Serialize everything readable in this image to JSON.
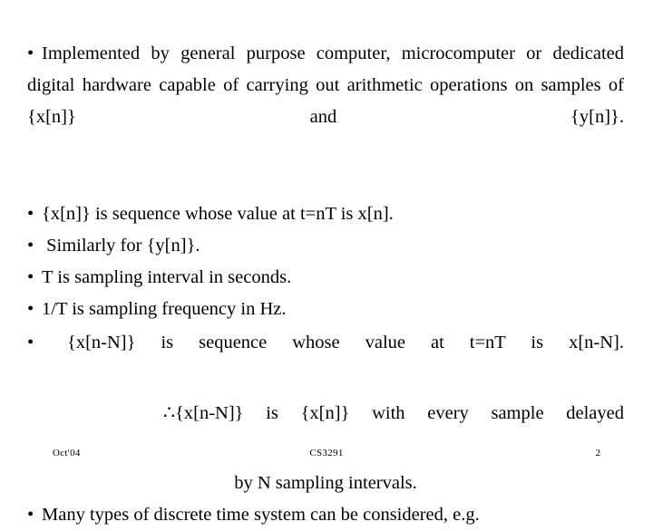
{
  "slide": {
    "background_color": "#ffffff",
    "text_color": "#000000",
    "bullet_glyph": "•",
    "therefore_glyph": "∴"
  },
  "body": {
    "paragraph_1": {
      "bullet": "•",
      "text": "Implemented by general purpose computer, microcomputer or dedicated digital hardware capable of carrying out arithmetic operations on samples of  {x[n]}  and  {y[n]}."
    },
    "bullets": [
      {
        "bullet": "•",
        "text": "{x[n]} is sequence whose value at t=nT is x[n]."
      },
      {
        "bullet": "•",
        "text": " Similarly for {y[n]}."
      },
      {
        "bullet": "•",
        "text": "T is sampling interval in seconds."
      },
      {
        "bullet": "•",
        "text": "1/T is sampling frequency in Hz."
      }
    ],
    "paragraph_2": {
      "bullet": "•",
      "text": "  {x[n-N]}  is  sequence  whose  value  at  t=nT  is  x[n-N]."
    },
    "paragraph_3": {
      "text": "∴{x[n-N]}   is  {x[n]} with  every  sample  delayed"
    },
    "centered_line": {
      "text": "by N sampling intervals."
    },
    "last_bullet": {
      "bullet": "•",
      "text": "Many types of discrete time system can be considered, e.g."
    }
  },
  "footer": {
    "date": "Oct'04",
    "course": "CS3291",
    "page_number": "2"
  }
}
